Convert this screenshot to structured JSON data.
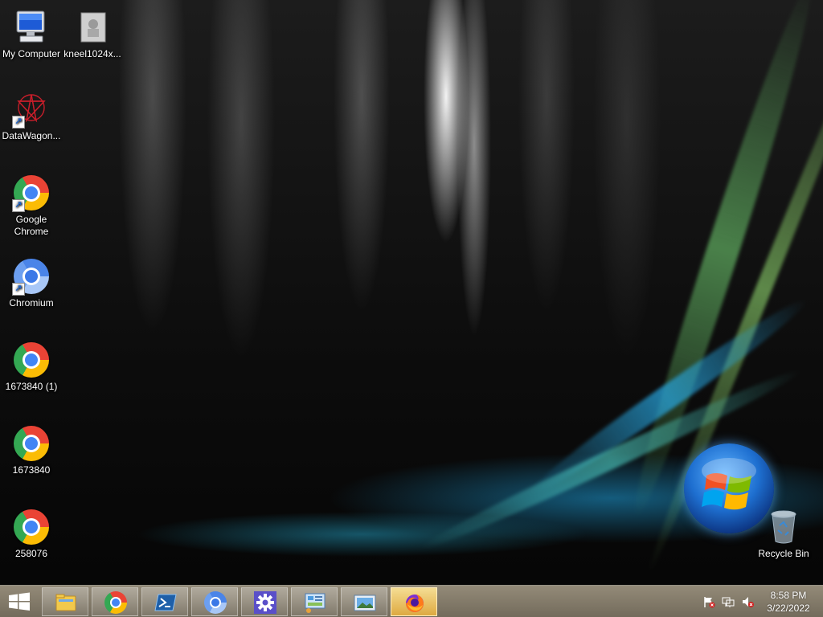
{
  "desktop": {
    "icons": [
      {
        "label": "My Computer",
        "icon": "my-computer-icon"
      },
      {
        "label": "kneel1024x...",
        "icon": "image-file-icon"
      },
      {
        "label": "DataWagon...",
        "icon": "datawagon-icon"
      },
      {
        "label": "Google Chrome",
        "icon": "chrome-icon"
      },
      {
        "label": "Chromium",
        "icon": "chromium-icon"
      },
      {
        "label": "1673840 (1)",
        "icon": "chrome-icon"
      },
      {
        "label": "1673840",
        "icon": "chrome-icon"
      },
      {
        "label": "258076",
        "icon": "chrome-icon"
      },
      {
        "label": "Recycle Bin",
        "icon": "recycle-bin-icon"
      }
    ]
  },
  "taskbar": {
    "start_icon": "windows-start-icon",
    "pinned": [
      {
        "icon": "file-explorer-icon"
      },
      {
        "icon": "chrome-icon"
      },
      {
        "icon": "powershell-icon"
      },
      {
        "icon": "chromium-icon"
      },
      {
        "icon": "settings-gear-icon"
      },
      {
        "icon": "control-panel-icon"
      },
      {
        "icon": "photo-viewer-icon"
      },
      {
        "icon": "firefox-icon",
        "active": true
      }
    ],
    "tray": {
      "icons": [
        "action-center-flag-icon",
        "network-icon",
        "volume-muted-icon"
      ],
      "time": "8:58 PM",
      "date": "3/22/2022"
    }
  },
  "colors": {
    "taskbar": "#9a8f7a",
    "active_button": "#f0c060",
    "desktop_text": "#ffffff"
  }
}
